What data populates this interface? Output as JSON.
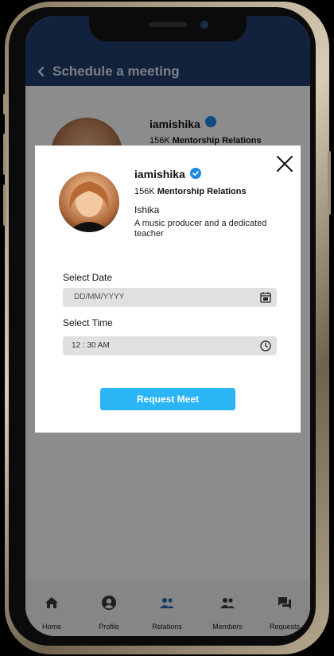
{
  "appbar": {
    "title": "Schedule a meeting",
    "back_icon": "chevron-left-icon"
  },
  "profile": {
    "username": "iamishika",
    "relations_count": "156K",
    "relations_label": "Mentorship Relations",
    "name": "Ishika",
    "bio": "A music producer and a dedicated teacher",
    "verified_icon": "verified-check-icon"
  },
  "form": {
    "date_label": "Select Date",
    "date_placeholder": "DD/MM/YYYY",
    "date_icon": "calendar-icon",
    "time_label": "Select Time",
    "time_value": "12 : 30 AM",
    "time_icon": "clock-icon",
    "submit_label": "Request Meet"
  },
  "nav": {
    "items": [
      {
        "label": "Home",
        "icon": "home-icon"
      },
      {
        "label": "Profile",
        "icon": "profile-icon"
      },
      {
        "label": "Relations",
        "icon": "relations-icon",
        "active": true
      },
      {
        "label": "Members",
        "icon": "members-icon"
      },
      {
        "label": "Requests",
        "icon": "requests-icon"
      }
    ]
  },
  "colors": {
    "appbar": "#213e70",
    "accent": "#2bb5f5",
    "verified": "#1e88e5",
    "nav_active": "#2a6ab8",
    "nav_inactive": "#3a3a3a"
  }
}
